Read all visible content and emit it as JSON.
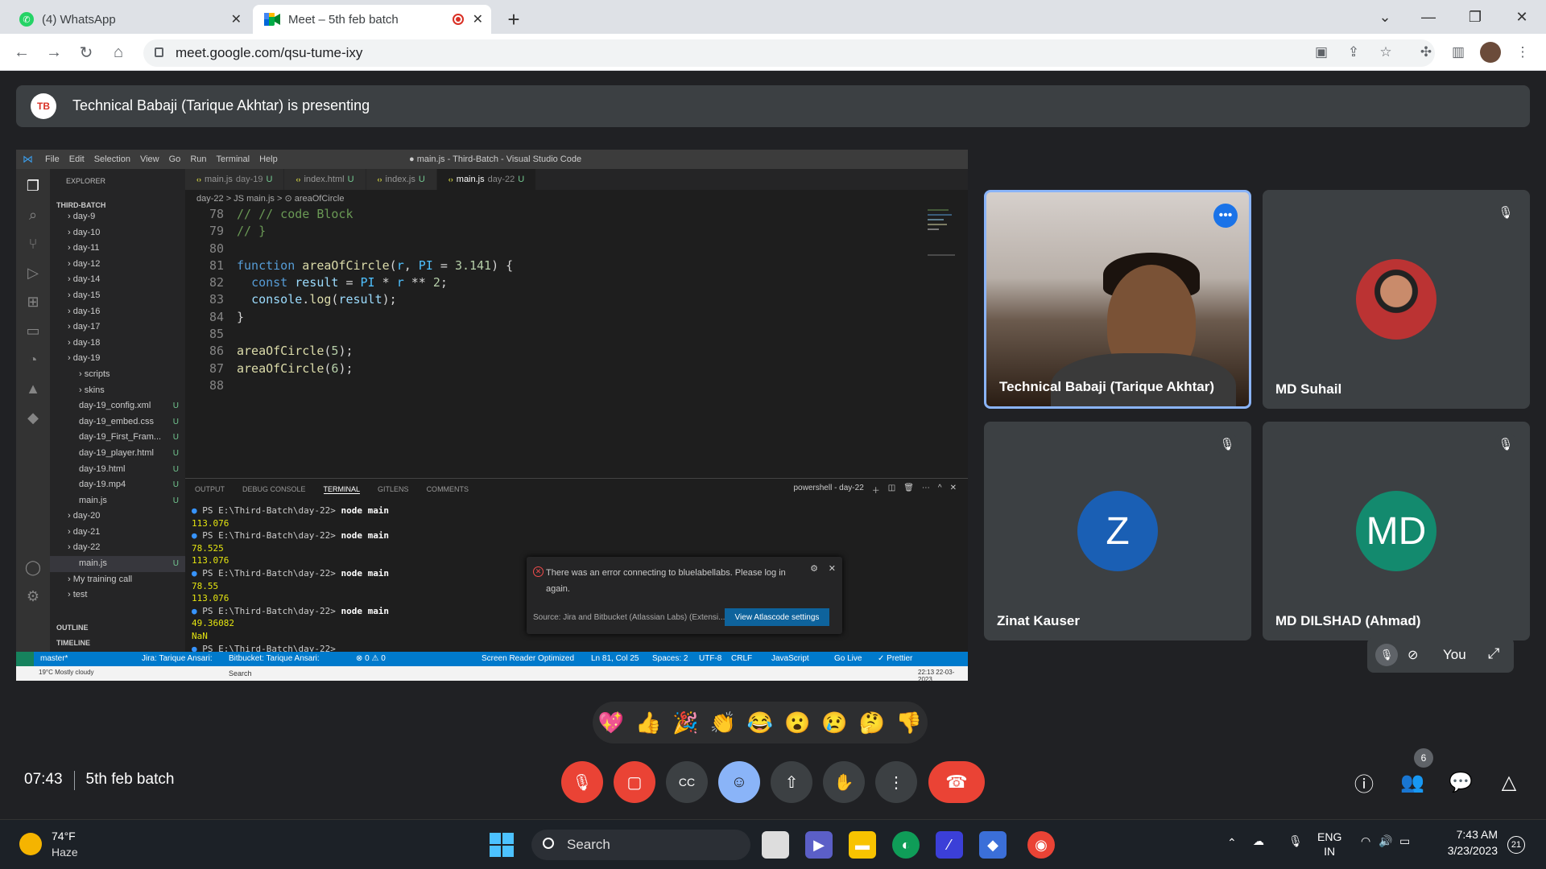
{
  "browser": {
    "tabs": [
      {
        "title": "(4) WhatsApp"
      },
      {
        "title": "Meet – 5th feb batch"
      }
    ],
    "url": "meet.google.com/qsu-tume-ixy"
  },
  "meet": {
    "presenting_banner": "Technical Babaji (Tarique Akhtar) is presenting",
    "presenter_initials": "TB",
    "time": "07:43",
    "meeting_name": "5th feb batch",
    "participant_count": "6",
    "participants": [
      {
        "name": "Technical Babaji (Tarique Akhtar)"
      },
      {
        "name": "MD Suhail"
      },
      {
        "name": "Zinat Kauser",
        "initial": "Z",
        "color": "#1a5fb4"
      },
      {
        "name": "MD DILSHAD (Ahmad)",
        "initial": "MD",
        "color": "#138a6e"
      }
    ],
    "self_label": "You",
    "reactions": [
      "💖",
      "👍",
      "🎉",
      "👏",
      "😂",
      "😮",
      "😢",
      "🤔",
      "👎"
    ]
  },
  "vscode": {
    "menu": [
      "File",
      "Edit",
      "Selection",
      "View",
      "Go",
      "Run",
      "Terminal",
      "Help"
    ],
    "title": "● main.js - Third-Batch - Visual Studio Code",
    "explorer_label": "EXPLORER",
    "root": "THIRD-BATCH",
    "tree": [
      {
        "label": "day-9",
        "type": "folder"
      },
      {
        "label": "day-10",
        "type": "folder"
      },
      {
        "label": "day-11",
        "type": "folder"
      },
      {
        "label": "day-12",
        "type": "folder"
      },
      {
        "label": "day-14",
        "type": "folder"
      },
      {
        "label": "day-15",
        "type": "folder"
      },
      {
        "label": "day-16",
        "type": "folder"
      },
      {
        "label": "day-17",
        "type": "folder"
      },
      {
        "label": "day-18",
        "type": "folder"
      },
      {
        "label": "day-19",
        "type": "folder"
      },
      {
        "label": "scripts",
        "type": "subfolder"
      },
      {
        "label": "skins",
        "type": "subfolder"
      },
      {
        "label": "day-19_config.xml",
        "type": "file",
        "status": "U"
      },
      {
        "label": "day-19_embed.css",
        "type": "file",
        "status": "U"
      },
      {
        "label": "day-19_First_Fram...",
        "type": "file",
        "status": "U"
      },
      {
        "label": "day-19_player.html",
        "type": "file",
        "status": "U"
      },
      {
        "label": "day-19.html",
        "type": "file",
        "status": "U"
      },
      {
        "label": "day-19.mp4",
        "type": "file",
        "status": "U"
      },
      {
        "label": "main.js",
        "type": "file",
        "status": "U"
      },
      {
        "label": "day-20",
        "type": "folder"
      },
      {
        "label": "day-21",
        "type": "folder"
      },
      {
        "label": "day-22",
        "type": "folder"
      },
      {
        "label": "main.js",
        "type": "file",
        "status": "U",
        "selected": true
      },
      {
        "label": "My training call",
        "type": "folder"
      },
      {
        "label": "test",
        "type": "folder"
      }
    ],
    "outline_label": "OUTLINE",
    "timeline_label": "TIMELINE",
    "editor_tabs": [
      {
        "label": "main.js",
        "sub": "day-19",
        "status": "U"
      },
      {
        "label": "index.html",
        "sub": "",
        "status": "U"
      },
      {
        "label": "index.js",
        "sub": "",
        "status": "U"
      },
      {
        "label": "main.js",
        "sub": "day-22",
        "status": "U",
        "active": true
      }
    ],
    "breadcrumb": "day-22 > JS main.js > ⊙ areaOfCircle",
    "code_lines": [
      {
        "n": "78",
        "text": "// // code Block"
      },
      {
        "n": "79",
        "text": "// }"
      },
      {
        "n": "80",
        "text": ""
      },
      {
        "n": "81",
        "text": "function areaOfCircle(r, PI = 3.141) {"
      },
      {
        "n": "82",
        "text": "  const result = PI * r ** 2;"
      },
      {
        "n": "83",
        "text": "  console.log(result);"
      },
      {
        "n": "84",
        "text": "}"
      },
      {
        "n": "85",
        "text": ""
      },
      {
        "n": "86",
        "text": "areaOfCircle(5);"
      },
      {
        "n": "87",
        "text": "areaOfCircle(6);"
      },
      {
        "n": "88",
        "text": ""
      }
    ],
    "panel_tabs": [
      "OUTPUT",
      "DEBUG CONSOLE",
      "TERMINAL",
      "GITLENS",
      "COMMENTS"
    ],
    "terminal_name": "powershell - day-22",
    "terminal": [
      {
        "prompt": "PS E:\\Third-Batch\\day-22>",
        "cmd": "node main"
      },
      {
        "out": "113.076"
      },
      {
        "prompt": "PS E:\\Third-Batch\\day-22>",
        "cmd": "node main"
      },
      {
        "out": "78.525"
      },
      {
        "out": "113.076"
      },
      {
        "prompt": "PS E:\\Third-Batch\\day-22>",
        "cmd": "node main"
      },
      {
        "out": "78.55"
      },
      {
        "out": "113.076"
      },
      {
        "prompt": "PS E:\\Third-Batch\\day-22>",
        "cmd": "node main"
      },
      {
        "out": "49.36082"
      },
      {
        "out": "NaN"
      },
      {
        "prompt": "PS E:\\Third-Batch\\day-22>",
        "cmd": ""
      }
    ],
    "notification": {
      "message": "There was an error connecting to bluelabellabs. Please log in again.",
      "source": "Source: Jira and Bitbucket (Atlassian Labs) (Extensi...",
      "button": "View Atlascode settings"
    },
    "status": {
      "branch": "master*",
      "jira": "Jira: Tarique Ansari:",
      "bitbucket": "Bitbucket: Tarique Ansari:",
      "problems": "⊗ 0 ⚠ 0",
      "reader": "Screen Reader Optimized",
      "position": "Ln 81, Col 25",
      "spaces": "Spaces: 2",
      "encoding": "UTF-8",
      "eol": "CRLF",
      "language": "JavaScript",
      "golive": "Go Live",
      "prettier": "✓ Prettier"
    },
    "win_weather": "19°C Mostly cloudy",
    "win_search": "Search",
    "win_clock": "22:13 22-03-2023"
  },
  "taskbar": {
    "temp": "74°F",
    "weather": "Haze",
    "search": "Search",
    "lang1": "ENG",
    "lang2": "IN",
    "time": "7:43 AM",
    "date": "3/23/2023",
    "notif_count": "21"
  }
}
